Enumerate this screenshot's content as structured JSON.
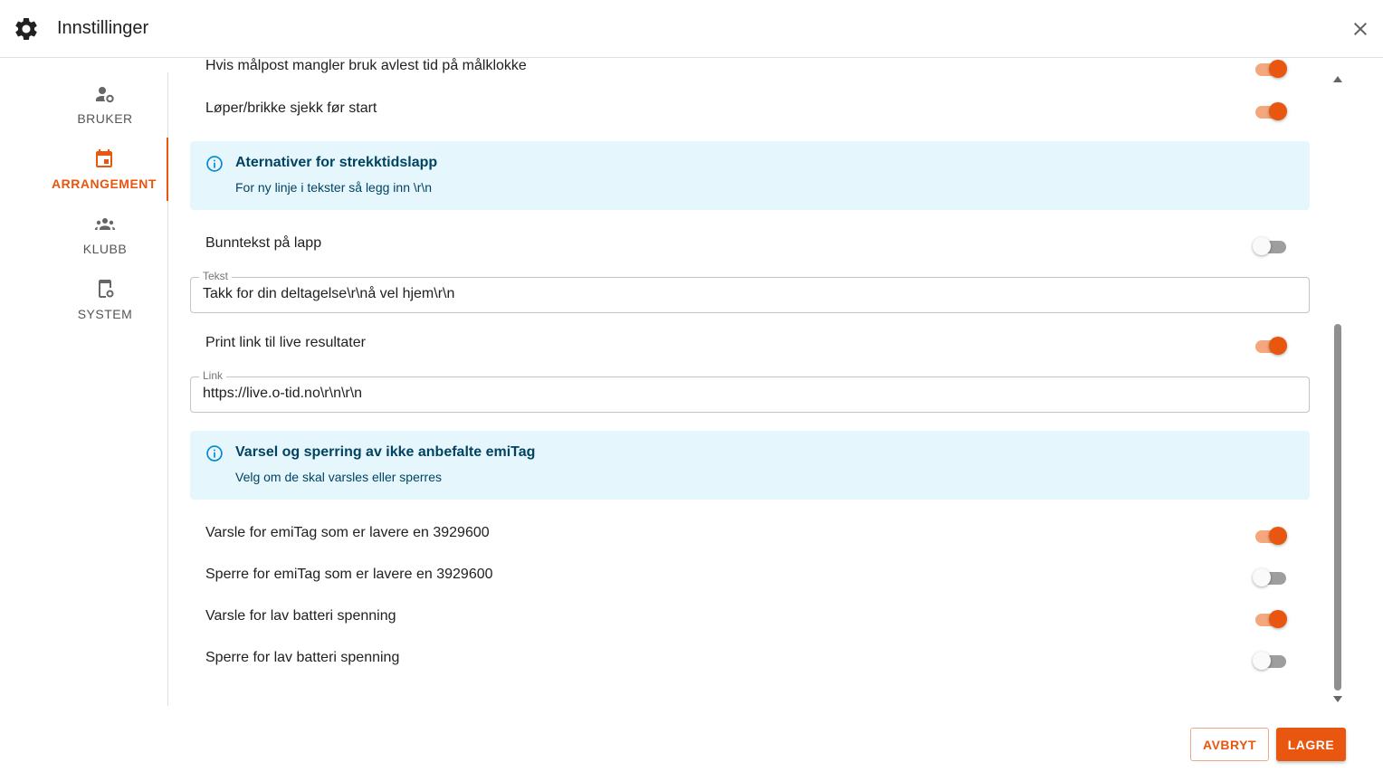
{
  "header": {
    "title": "Innstillinger",
    "settings_icon": "gear-icon",
    "close_icon": "close-icon"
  },
  "sidebar": {
    "items": [
      {
        "label": "BRUKER",
        "icon": "user-settings-icon",
        "active": false
      },
      {
        "label": "ARRANGEMENT",
        "icon": "calendar-icon",
        "active": true
      },
      {
        "label": "KLUBB",
        "icon": "group-icon",
        "active": false
      },
      {
        "label": "SYSTEM",
        "icon": "device-settings-icon",
        "active": false
      }
    ]
  },
  "settings": {
    "partial_top": {
      "label": "Hvis målpost mangler bruk avlest tid på målklokke",
      "on": true
    },
    "loper_brikke": {
      "label": "Løper/brikke sjekk før start",
      "on": true
    },
    "info_strekktid": {
      "title": "Aternativer for strekktidslapp",
      "subtitle": "For ny linje i tekster så legg inn \\r\\n"
    },
    "bunntekst": {
      "label": "Bunntekst på lapp",
      "on": false
    },
    "tekst_field": {
      "legend": "Tekst",
      "value": "Takk for din deltagelse\\r\\nå vel hjem\\r\\n"
    },
    "print_link": {
      "label": "Print link til live resultater",
      "on": true
    },
    "link_field": {
      "legend": "Link",
      "value": "https://live.o-tid.no\\r\\n\\r\\n"
    },
    "info_emitag": {
      "title": "Varsel og sperring av ikke anbefalte emiTag",
      "subtitle": "Velg om de skal varsles eller sperres"
    },
    "varsle_emitag": {
      "label": "Varsle for emiTag som er lavere en 3929600",
      "on": true
    },
    "sperre_emitag": {
      "label": "Sperre for emiTag som er lavere en 3929600",
      "on": false
    },
    "varsle_batteri": {
      "label": "Varsle for lav batteri spenning",
      "on": true
    },
    "sperre_batteri": {
      "label": "Sperre for lav batteri spenning",
      "on": false
    }
  },
  "footer": {
    "cancel_label": "AVBRYT",
    "save_label": "LAGRE"
  },
  "colors": {
    "accent": "#e8560f",
    "info_bg": "#e5f6fd",
    "info_text": "#014361"
  }
}
